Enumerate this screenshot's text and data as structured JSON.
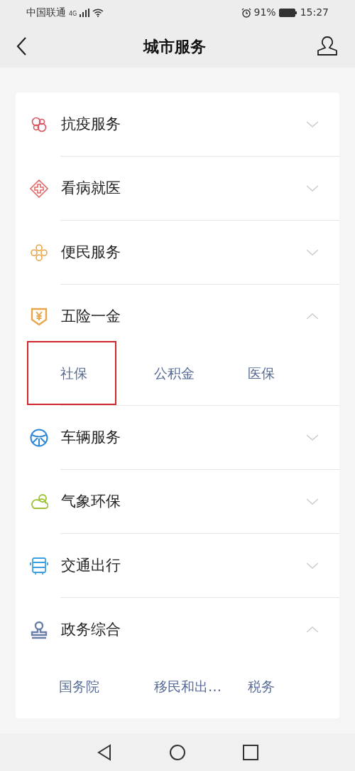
{
  "status_bar": {
    "carrier": "中国联通",
    "network": "4G",
    "battery": "91%",
    "time": "15:27"
  },
  "header": {
    "title": "城市服务"
  },
  "categories": [
    {
      "label": "抗疫服务",
      "color": "#d9545f",
      "expanded": false
    },
    {
      "label": "看病就医",
      "color": "#e06a6a",
      "expanded": false
    },
    {
      "label": "便民服务",
      "color": "#e8a54a",
      "expanded": false
    },
    {
      "label": "五险一金",
      "color": "#e8a54a",
      "expanded": true,
      "children": [
        {
          "label": "社保",
          "highlighted": true
        },
        {
          "label": "公积金",
          "highlighted": false
        },
        {
          "label": "医保",
          "highlighted": false
        }
      ]
    },
    {
      "label": "车辆服务",
      "color": "#2e86d6",
      "expanded": false
    },
    {
      "label": "气象环保",
      "color": "#9cc234",
      "expanded": false
    },
    {
      "label": "交通出行",
      "color": "#3aa0e0",
      "expanded": false
    },
    {
      "label": "政务综合",
      "color": "#6a7fa8",
      "expanded": true,
      "children": [
        {
          "label": "国务院",
          "highlighted": false
        },
        {
          "label": "移民和出…",
          "highlighted": false
        },
        {
          "label": "税务",
          "highlighted": false
        }
      ]
    }
  ]
}
